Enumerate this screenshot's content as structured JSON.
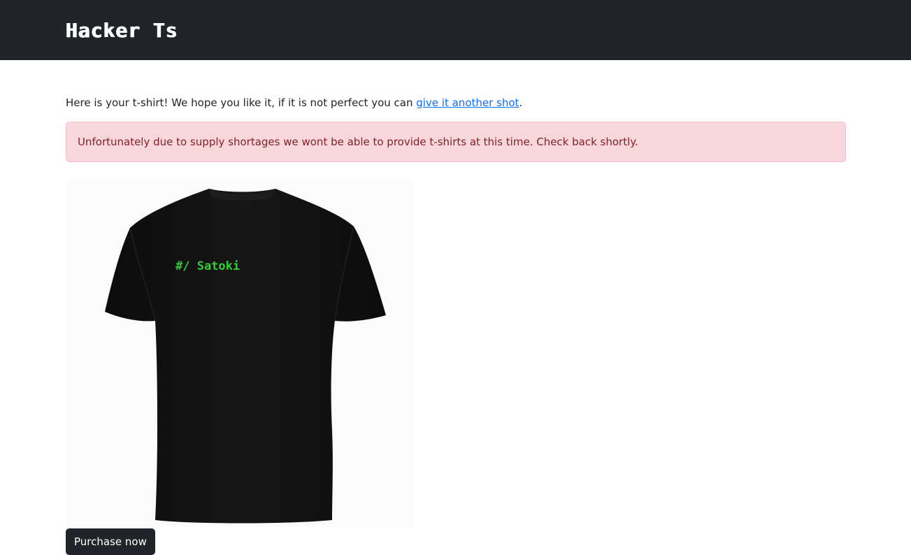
{
  "navbar": {
    "brand": "Hacker Ts",
    "background": "#212529"
  },
  "intro": {
    "text_before": "Here is your t-shirt! We hope you like it, if it is not perfect you can ",
    "link_text": "give it another shot",
    "text_after": "."
  },
  "alert": {
    "message": "Unfortunately due to supply shortages we wont be able to provide t-shirts at this time. Check back shortly.",
    "background": "#f8d7da",
    "color": "#842029"
  },
  "shirt": {
    "color": "#111111",
    "print_text": "#/ Satoki",
    "print_color": "#33cc33"
  },
  "purchase_button": {
    "label": "Purchase now"
  },
  "colors": {
    "link": "#0d6efd",
    "text": "#212529"
  }
}
